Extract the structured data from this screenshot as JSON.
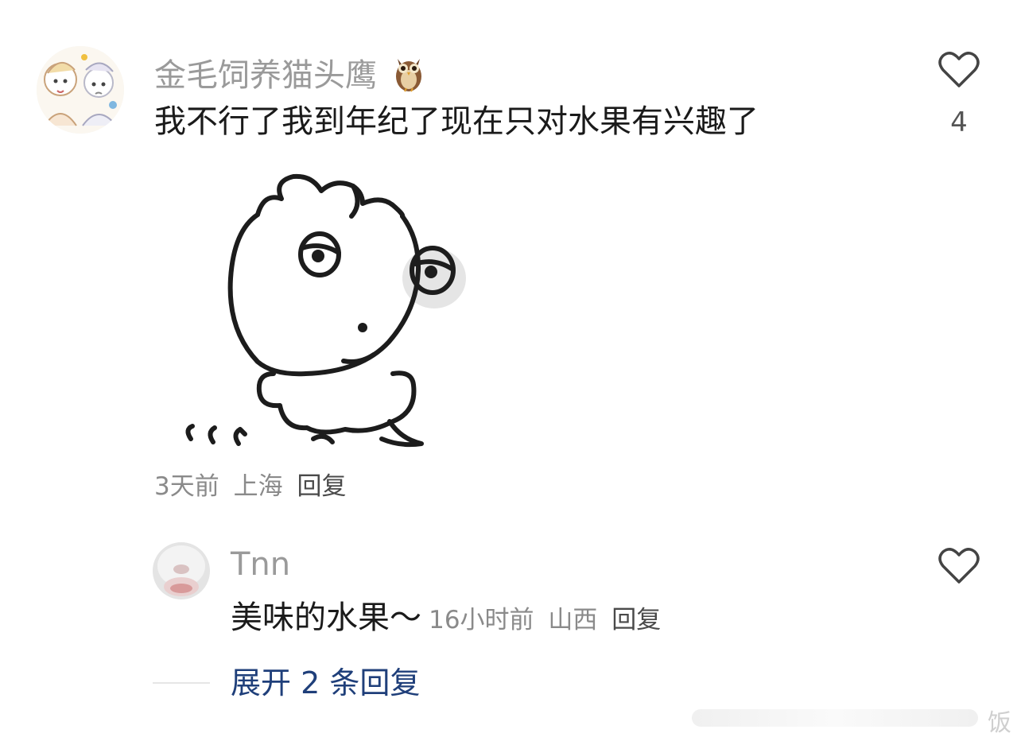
{
  "comment": {
    "username": "金毛饲养猫头鹰",
    "username_emoji": "🦉",
    "text": "我不行了我到年纪了现在只对水果有兴趣了",
    "like_count": "4",
    "time": "3天前",
    "location": "上海",
    "reply_label": "回复"
  },
  "reply": {
    "username": "Tnn",
    "text": "美味的水果～",
    "time": "16小时前",
    "location": "山西",
    "reply_label": "回复"
  },
  "expand_label": "展开 2 条回复",
  "watermark_text": "饭",
  "colors": {
    "username": "#9a9a9a",
    "text": "#1a1a1a",
    "meta": "#8a8a8a",
    "expand_link": "#1f3f7a"
  }
}
